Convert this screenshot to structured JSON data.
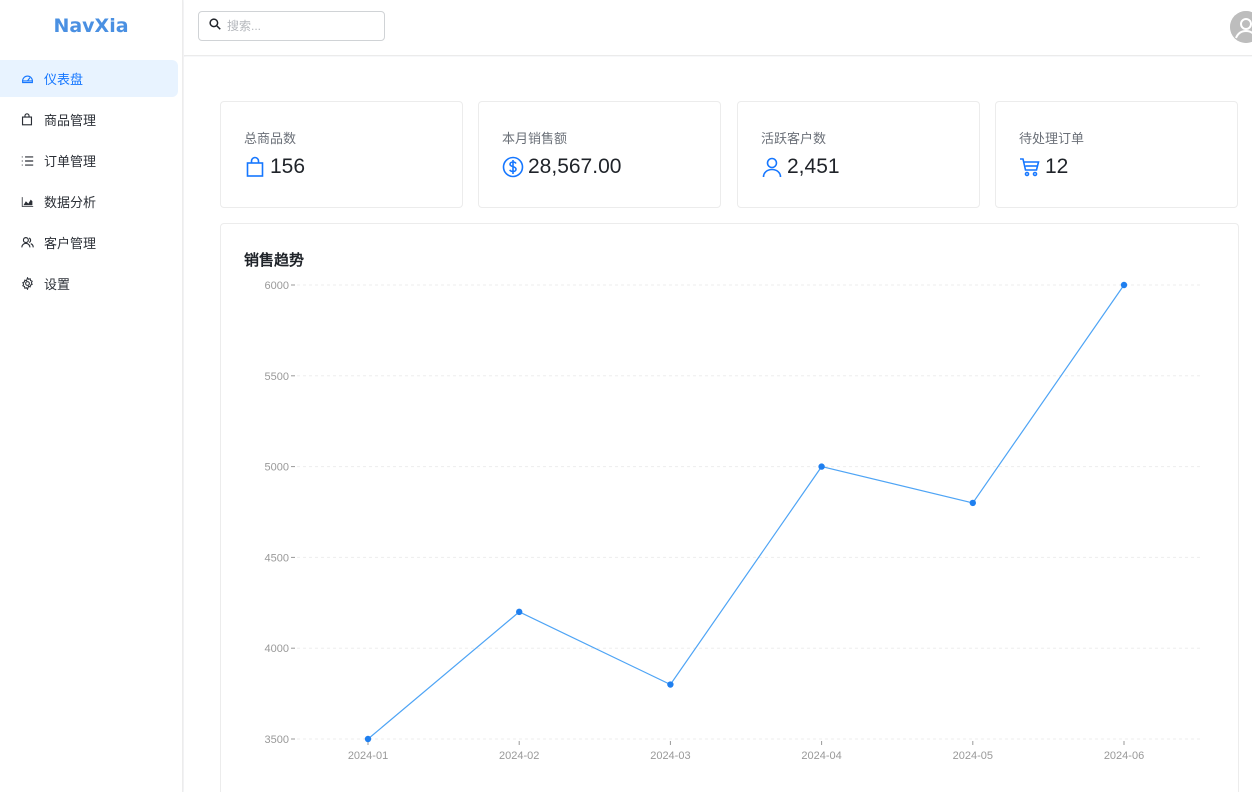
{
  "app": {
    "logo": "NavXia"
  },
  "sidebar": {
    "items": [
      {
        "label": "仪表盘",
        "icon": "dashboard-icon",
        "active": true
      },
      {
        "label": "商品管理",
        "icon": "shopping-bag-icon"
      },
      {
        "label": "订单管理",
        "icon": "list-icon"
      },
      {
        "label": "数据分析",
        "icon": "area-chart-icon"
      },
      {
        "label": "客户管理",
        "icon": "users-icon"
      },
      {
        "label": "设置",
        "icon": "gear-icon"
      }
    ]
  },
  "header": {
    "search": {
      "placeholder": "搜索...",
      "value": ""
    }
  },
  "stats": [
    {
      "title": "总商品数",
      "value": "156",
      "icon": "shopping-bag-icon"
    },
    {
      "title": "本月销售额",
      "value": "28,567.00",
      "icon": "dollar-circle-icon"
    },
    {
      "title": "活跃客户数",
      "value": "2,451",
      "icon": "user-icon"
    },
    {
      "title": "待处理订单",
      "value": "12",
      "icon": "cart-icon"
    }
  ],
  "colors": {
    "accent": "#1677ff",
    "line": "#4ea4f5",
    "point": "#1f7fef",
    "active_bg": "#e8f3ff"
  },
  "chart_data": {
    "type": "line",
    "title": "销售趋势",
    "categories": [
      "2024-01",
      "2024-02",
      "2024-03",
      "2024-04",
      "2024-05",
      "2024-06"
    ],
    "values": [
      3500,
      4200,
      3800,
      5000,
      4800,
      6000
    ],
    "ylim": [
      3500,
      6000
    ],
    "yticks": [
      "3500",
      "4000",
      "4500",
      "5000",
      "5500",
      "6000"
    ],
    "grid": true,
    "xlabel": "",
    "ylabel": ""
  }
}
